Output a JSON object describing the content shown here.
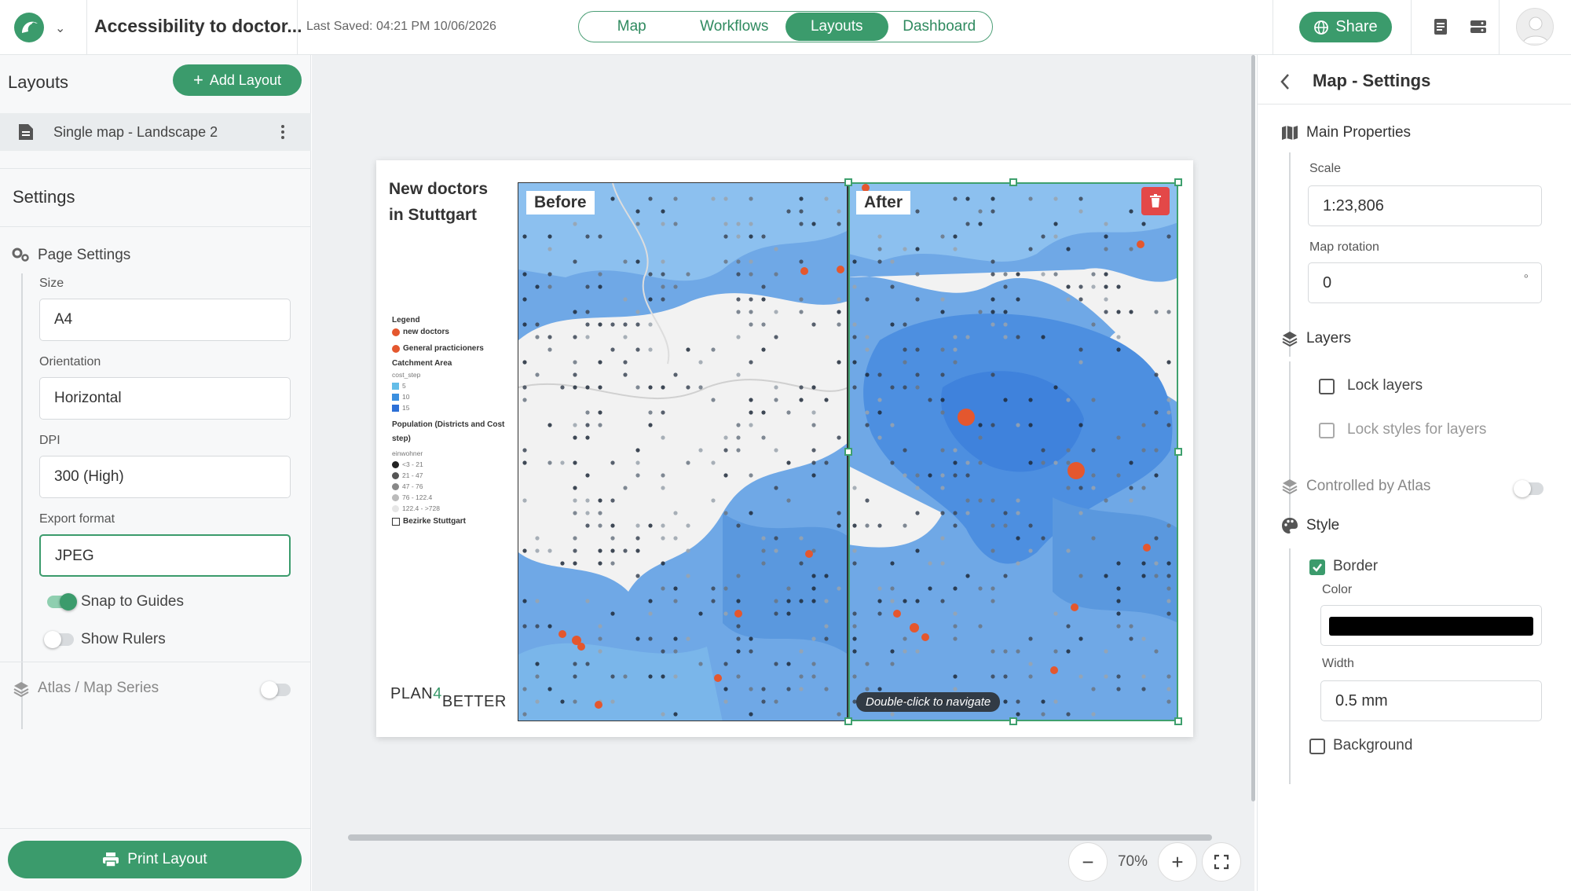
{
  "topbar": {
    "project_title": "Accessibility to doctor...",
    "last_saved": "Last Saved: 04:21 PM 10/06/2026",
    "tabs": [
      {
        "label": "Map",
        "active": false
      },
      {
        "label": "Workflows",
        "active": false
      },
      {
        "label": "Layouts",
        "active": true
      },
      {
        "label": "Dashboard",
        "active": false
      }
    ],
    "share_label": "Share",
    "accent_color": "#3b9b6c"
  },
  "left_panel": {
    "header": "Layouts",
    "add_layout_label": "Add Layout",
    "layout_item": "Single map - Landscape 2",
    "settings_header": "Settings",
    "page_settings_label": "Page Settings",
    "size_label": "Size",
    "size_value": "A4",
    "orientation_label": "Orientation",
    "orientation_value": "Horizontal",
    "dpi_label": "DPI",
    "dpi_value": "300 (High)",
    "export_label": "Export format",
    "export_value": "JPEG",
    "snap_label": "Snap to Guides",
    "snap_on": true,
    "rulers_label": "Show Rulers",
    "rulers_on": false,
    "atlas_label": "Atlas / Map Series",
    "atlas_on": false,
    "print_label": "Print Layout"
  },
  "canvas": {
    "page_title": "New doctors in Stuttgart",
    "legend": {
      "title": "Legend",
      "new_doctors": "new doctors",
      "gp": "General practicioners",
      "catchment_title": "Catchment Area",
      "catchment_sub": "cost_step",
      "catchment_items": [
        "5",
        "10",
        "15"
      ],
      "catchment_colors": [
        "#64bde8",
        "#3b8fdf",
        "#2c6fd6"
      ],
      "population_title": "Population (Districts and Cost step)",
      "population_sub": "einwohner",
      "population_items": [
        "<3 - 21",
        "21 - 47",
        "47 - 76",
        "76 - 122.4",
        "122.4 - >728"
      ],
      "population_colors": [
        "#222222",
        "#555555",
        "#888888",
        "#bbbbbb",
        "#e6e6e6"
      ],
      "districts": "Bezirke Stuttgart"
    },
    "brand_a": "PLAN",
    "brand_four": "4",
    "brand_b": "BETTER",
    "map_before_label": "Before",
    "map_after_label": "After",
    "hint": "Double-click to navigate",
    "zoom": "70%"
  },
  "right_panel": {
    "title": "Map - Settings",
    "main_properties": "Main Properties",
    "scale_label": "Scale",
    "scale_value": "1:23,806",
    "rotation_label": "Map rotation",
    "rotation_value": "0",
    "rotation_unit": "°",
    "layers_label": "Layers",
    "lock_layers": "Lock layers",
    "lock_styles": "Lock styles for layers",
    "atlas_control": "Controlled by Atlas",
    "style_label": "Style",
    "border_label": "Border",
    "border_checked": true,
    "color_label": "Color",
    "border_color": "#000000",
    "width_label": "Width",
    "width_value": "0.5 mm",
    "background_label": "Background",
    "background_checked": false
  }
}
